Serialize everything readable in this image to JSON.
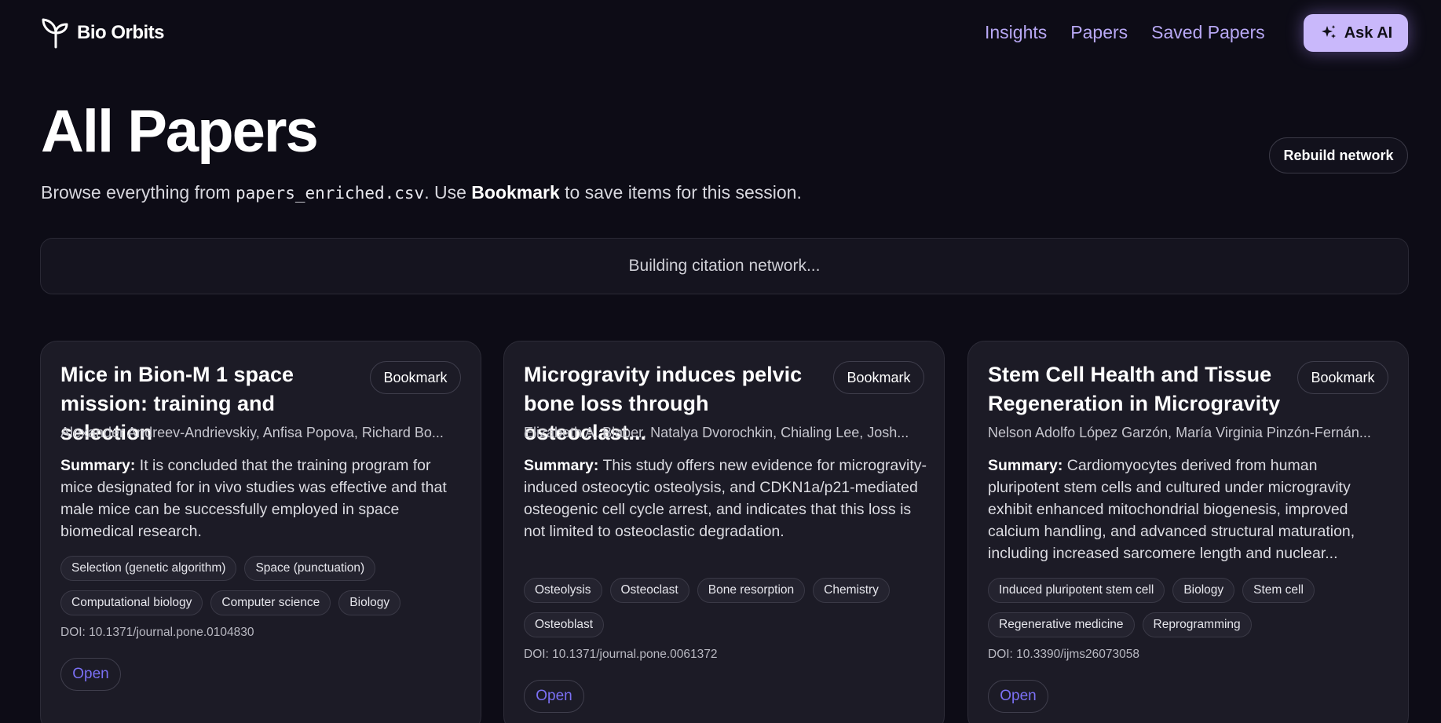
{
  "header": {
    "brand": "Bio Orbits",
    "nav": [
      "Insights",
      "Papers",
      "Saved Papers"
    ],
    "ask_ai": "Ask AI"
  },
  "page": {
    "title": "All Papers",
    "subtitle_prefix": "Browse everything from ",
    "subtitle_file": "papers_enriched.csv",
    "subtitle_mid": ". Use ",
    "subtitle_bold": "Bookmark",
    "subtitle_suffix": " to save items for this session.",
    "rebuild_button": "Rebuild network",
    "status": "Building citation network..."
  },
  "labels": {
    "bookmark": "Bookmark",
    "summary": "Summary:",
    "doi_prefix": "DOI: ",
    "open": "Open"
  },
  "papers": [
    {
      "title": "Mice in Bion-M 1 space mission: training and selection",
      "authors": "Alexander Andreev-Andrievskiy, Anfisa Popova, Richard Bo...",
      "summary": "It is concluded that the training program for mice designated for in vivo studies was effective and that male mice can be successfully employed in space biomedical research.",
      "tags": [
        "Selection (genetic algorithm)",
        "Space (punctuation)",
        "Computational biology",
        "Computer science",
        "Biology"
      ],
      "doi": "10.1371/journal.pone.0104830"
    },
    {
      "title": "Microgravity induces pelvic bone loss through osteoclast...",
      "authors": "Elizabeth A. Blaber, Natalya Dvorochkin, Chialing Lee, Josh...",
      "summary": "This study offers new evidence for microgravity-induced osteocytic osteolysis, and CDKN1a/p21-mediated osteogenic cell cycle arrest, and indicates that this loss is not limited to osteoclastic degradation.",
      "tags": [
        "Osteolysis",
        "Osteoclast",
        "Bone resorption",
        "Chemistry",
        "Osteoblast"
      ],
      "doi": "10.1371/journal.pone.0061372"
    },
    {
      "title": "Stem Cell Health and Tissue Regeneration in Microgravity",
      "authors": "Nelson Adolfo López Garzón, María Virginia Pinzón-Fernán...",
      "summary": "Cardiomyocytes derived from human pluripotent stem cells and cultured under microgravity exhibit enhanced mitochondrial biogenesis, improved calcium handling, and advanced structural maturation, including increased sarcomere length and nuclear...",
      "tags": [
        "Induced pluripotent stem cell",
        "Biology",
        "Stem cell",
        "Regenerative medicine",
        "Reprogramming"
      ],
      "doi": "10.3390/ijms26073058"
    }
  ],
  "colors": {
    "background": "#0d0c16",
    "accent": "#c9b8fb",
    "nav": "#b8a8f5",
    "link": "#7b70f5"
  }
}
